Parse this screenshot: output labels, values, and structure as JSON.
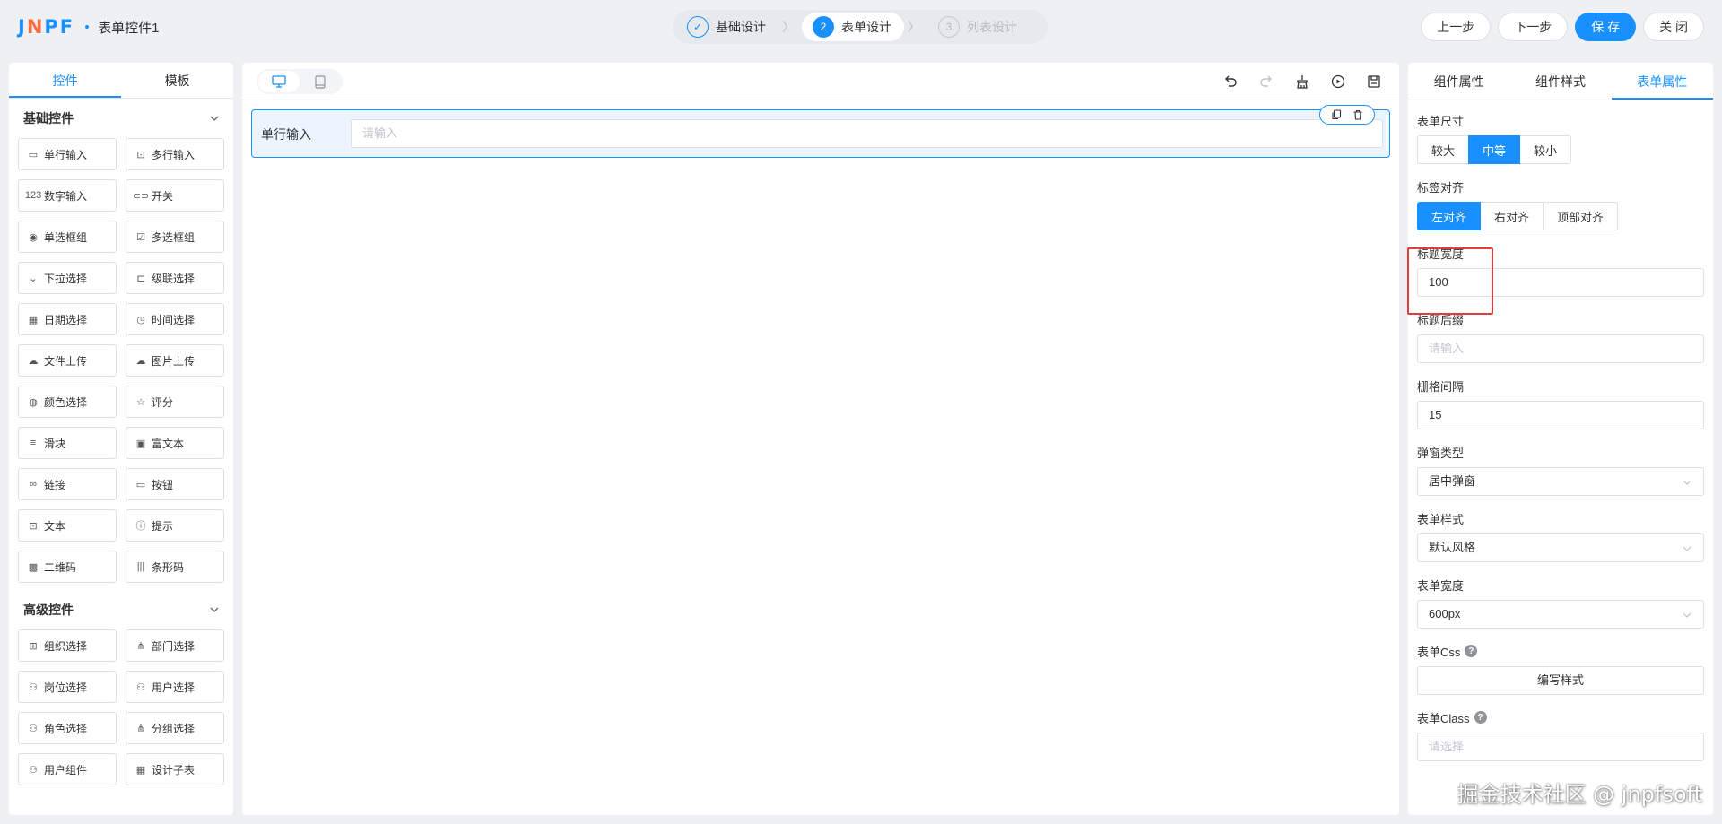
{
  "app": {
    "logo_prefix": "J",
    "logo_o": "N",
    "logo_suffix": "PF",
    "title": "表单控件1"
  },
  "steps": [
    {
      "num": "✓",
      "label": "基础设计",
      "state": "done"
    },
    {
      "num": "2",
      "label": "表单设计",
      "state": "current"
    },
    {
      "num": "3",
      "label": "列表设计",
      "state": "next"
    }
  ],
  "header_buttons": {
    "prev": "上一步",
    "next": "下一步",
    "save": "保 存",
    "close": "关 闭"
  },
  "left_panel": {
    "tabs": [
      "控件",
      "模板"
    ],
    "basic_title": "基础控件",
    "advanced_title": "高级控件",
    "basic": [
      {
        "icon": "single-line-input-icon",
        "glyph": "▭",
        "label": "单行输入"
      },
      {
        "icon": "multi-line-input-icon",
        "glyph": "⊡",
        "label": "多行输入"
      },
      {
        "icon": "number-input-icon",
        "glyph": "123",
        "label": "数字输入"
      },
      {
        "icon": "switch-icon",
        "glyph": "⊂⊃",
        "label": "开关"
      },
      {
        "icon": "radio-group-icon",
        "glyph": "◉",
        "label": "单选框组"
      },
      {
        "icon": "checkbox-group-icon",
        "glyph": "☑",
        "label": "多选框组"
      },
      {
        "icon": "dropdown-icon",
        "glyph": "⌄",
        "label": "下拉选择"
      },
      {
        "icon": "cascader-icon",
        "glyph": "⊏",
        "label": "级联选择"
      },
      {
        "icon": "date-picker-icon",
        "glyph": "▦",
        "label": "日期选择"
      },
      {
        "icon": "time-picker-icon",
        "glyph": "◷",
        "label": "时间选择"
      },
      {
        "icon": "file-upload-icon",
        "glyph": "☁",
        "label": "文件上传"
      },
      {
        "icon": "image-upload-icon",
        "glyph": "☁",
        "label": "图片上传"
      },
      {
        "icon": "color-picker-icon",
        "glyph": "◍",
        "label": "颜色选择"
      },
      {
        "icon": "rate-icon",
        "glyph": "☆",
        "label": "评分"
      },
      {
        "icon": "slider-icon",
        "glyph": "≡",
        "label": "滑块"
      },
      {
        "icon": "rich-text-icon",
        "glyph": "▣",
        "label": "富文本"
      },
      {
        "icon": "link-icon",
        "glyph": "∞",
        "label": "链接"
      },
      {
        "icon": "button-icon",
        "glyph": "▭",
        "label": "按钮"
      },
      {
        "icon": "text-icon",
        "glyph": "⊡",
        "label": "文本"
      },
      {
        "icon": "alert-icon",
        "glyph": "ⓘ",
        "label": "提示"
      },
      {
        "icon": "qrcode-icon",
        "glyph": "▩",
        "label": "二维码"
      },
      {
        "icon": "barcode-icon",
        "glyph": "|||",
        "label": "条形码"
      }
    ],
    "advanced": [
      {
        "icon": "org-select-icon",
        "glyph": "⊞",
        "label": "组织选择"
      },
      {
        "icon": "dept-select-icon",
        "glyph": "⋔",
        "label": "部门选择"
      },
      {
        "icon": "post-select-icon",
        "glyph": "⚇",
        "label": "岗位选择"
      },
      {
        "icon": "user-select-icon",
        "glyph": "⚇",
        "label": "用户选择"
      },
      {
        "icon": "role-select-icon",
        "glyph": "⚇",
        "label": "角色选择"
      },
      {
        "icon": "group-select-icon",
        "glyph": "⋔",
        "label": "分组选择"
      },
      {
        "icon": "user-component-icon",
        "glyph": "⚇",
        "label": "用户组件"
      },
      {
        "icon": "sub-table-icon",
        "glyph": "▦",
        "label": "设计子表"
      }
    ]
  },
  "canvas": {
    "field_label": "单行输入",
    "field_placeholder": "请输入"
  },
  "right_panel": {
    "tabs": [
      "组件属性",
      "组件样式",
      "表单属性"
    ],
    "form_size_label": "表单尺寸",
    "form_size_options": [
      "较大",
      "中等",
      "较小"
    ],
    "label_align_label": "标签对齐",
    "label_align_options": [
      "左对齐",
      "右对齐",
      "顶部对齐"
    ],
    "label_width_label": "标题宽度",
    "label_width_value": "100",
    "label_suffix_label": "标题后缀",
    "label_suffix_placeholder": "请输入",
    "gutter_label": "栅格间隔",
    "gutter_value": "15",
    "popup_type_label": "弹窗类型",
    "popup_type_value": "居中弹窗",
    "form_style_label": "表单样式",
    "form_style_value": "默认风格",
    "form_width_label": "表单宽度",
    "form_width_value": "600px",
    "form_css_label": "表单Css",
    "form_css_button": "编写样式",
    "form_class_label": "表单Class",
    "form_class_placeholder": "请选择"
  },
  "watermark": "掘金技术社区 @ jnpfsoft",
  "colors": {
    "primary": "#1890ff",
    "highlight": "#e23b3b",
    "logo_accent": "#ff6a3d"
  }
}
